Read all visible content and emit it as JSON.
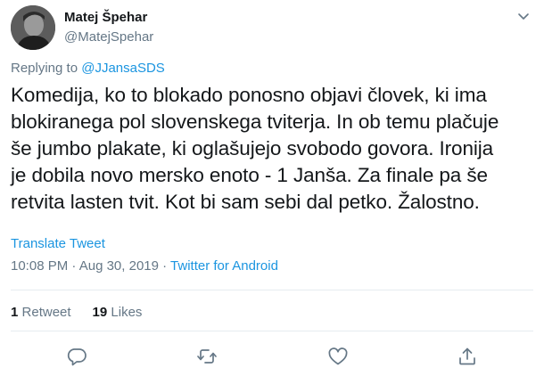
{
  "author": {
    "name": "Matej Špehar",
    "handle": "@MatejSpehar"
  },
  "reply": {
    "prefix": "Replying to ",
    "target": "@JJansaSDS"
  },
  "tweet": {
    "lines": [
      "Komedija, ko to blokado ponosno objavi človek, ki ima",
      "blokiranega pol slovenskega tviterja. In ob temu plačuje",
      "še jumbo plakate, ki oglašujejo svobodo govora. Ironija",
      "je dobila novo mersko enoto - 1 Janša. Za finale pa še",
      "retvita lasten tvit. Kot bi sam sebi dal petko. Žalostno."
    ],
    "translate_label": "Translate Tweet",
    "time": "10:08 PM",
    "date": "Aug 30, 2019",
    "separator": " · ",
    "source": "Twitter for Android"
  },
  "stats": {
    "retweets_count": "1",
    "retweets_label": "Retweet",
    "likes_count": "19",
    "likes_label": "Likes"
  },
  "icons": {
    "reply": "reply-icon",
    "retweet": "retweet-icon",
    "like": "heart-icon",
    "share": "share-icon",
    "menu": "chevron-down-icon"
  },
  "colors": {
    "link": "#1b95e0",
    "secondary_text": "#657786",
    "primary_text": "#14171a",
    "divider": "#e6ecf0"
  }
}
